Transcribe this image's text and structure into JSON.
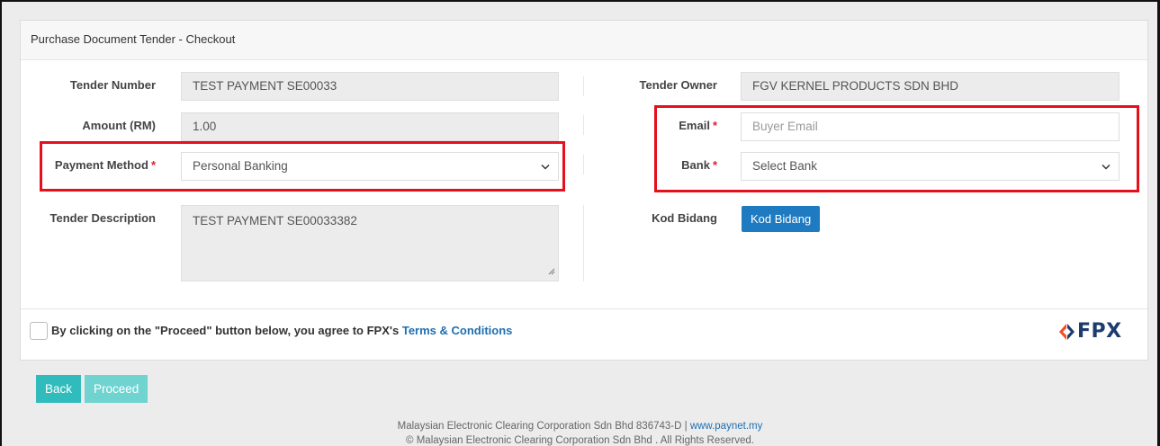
{
  "panel": {
    "title": "Purchase Document Tender - Checkout"
  },
  "form": {
    "tender_number": {
      "label": "Tender Number",
      "value": "TEST PAYMENT SE00033"
    },
    "amount": {
      "label": "Amount (RM)",
      "value": "1.00"
    },
    "payment_method": {
      "label": "Payment Method",
      "required": "*",
      "selected": "Personal Banking"
    },
    "tender_description": {
      "label": "Tender Description",
      "value": "TEST PAYMENT SE00033382"
    },
    "tender_owner": {
      "label": "Tender Owner",
      "value": "FGV KERNEL PRODUCTS SDN BHD"
    },
    "email": {
      "label": "Email",
      "required": "*",
      "placeholder": "Buyer Email"
    },
    "bank": {
      "label": "Bank",
      "required": "*",
      "selected": "Select Bank"
    },
    "kod_bidang": {
      "label": "Kod Bidang",
      "button": "Kod Bidang"
    }
  },
  "agreement": {
    "text": "By clicking on the \"Proceed\" button below, you agree to FPX's",
    "link": "Terms & Conditions"
  },
  "logo": {
    "text": "FPX",
    "icon": "fpx-logo-icon",
    "color": "#1d3b6d"
  },
  "actions": {
    "back": "Back",
    "proceed": "Proceed"
  },
  "footer": {
    "company": "Malaysian Electronic Clearing Corporation Sdn Bhd 836743-D |",
    "link": "www.paynet.my",
    "copyright": "© Malaysian Electronic Clearing Corporation Sdn Bhd . All Rights Reserved."
  },
  "colors": {
    "highlight": "#e5101b",
    "primary": "#1f7bc1",
    "teal": "#30bcbc",
    "required": "#d9232d"
  }
}
